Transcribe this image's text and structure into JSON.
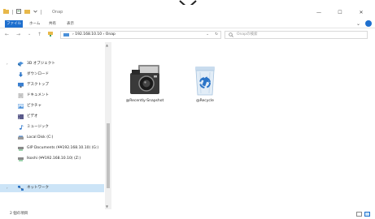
{
  "window": {
    "title": "Onap",
    "controls": {
      "minimize": "—",
      "maximize": "☐",
      "close": "✕"
    }
  },
  "ribbon": {
    "tabs": [
      "ファイル",
      "ホーム",
      "共有",
      "表示"
    ],
    "expand_glyph": "⌄",
    "help_glyph": "?"
  },
  "nav": {
    "back": "←",
    "forward": "→",
    "recent": "⌄",
    "up": "↑",
    "address_path": "› 192.168.10.10 › Onap",
    "address_dropdown": "⌄",
    "refresh": "↻",
    "search_placeholder": "Onapの検索"
  },
  "sidebar": {
    "items": [
      {
        "label": "3D オブジェクト",
        "icon": "3d-objects-icon",
        "color": "#4a90d9"
      },
      {
        "label": "ダウンロード",
        "icon": "downloads-icon",
        "color": "#2b74c7"
      },
      {
        "label": "デスクトップ",
        "icon": "desktop-icon",
        "color": "#3a7fd0"
      },
      {
        "label": "ドキュメント",
        "icon": "documents-icon",
        "color": "#8a8a8a"
      },
      {
        "label": "ピクチャ",
        "icon": "pictures-icon",
        "color": "#4a90d9"
      },
      {
        "label": "ビデオ",
        "icon": "videos-icon",
        "color": "#5a5a8a"
      },
      {
        "label": "ミュージック",
        "icon": "music-icon",
        "color": "#3a7fd0"
      },
      {
        "label": "Local Disk (C:)",
        "icon": "disk-icon",
        "color": "#7a7a7a"
      },
      {
        "label": "GIP Documents (¥¥192.168.10.10) (G:)",
        "icon": "network-drive-icon",
        "color": "#3aa35a"
      },
      {
        "label": "Ikoshi (¥¥192.168.10.10) (Z:)",
        "icon": "network-drive-icon",
        "color": "#3aa35a"
      },
      {
        "label": "ネットワーク",
        "icon": "network-icon",
        "color": "#2b74c7"
      }
    ],
    "selected_index": 10,
    "expander": "›"
  },
  "content": {
    "items": [
      {
        "name": "@Recently-Snapshot",
        "icon": "camera-icon"
      },
      {
        "name": "@Recycle",
        "icon": "recycle-bin-icon"
      }
    ]
  },
  "status": {
    "text": "2 個の項目"
  },
  "colors": {
    "accent": "#1e6fce",
    "selection": "#cce4f7"
  }
}
